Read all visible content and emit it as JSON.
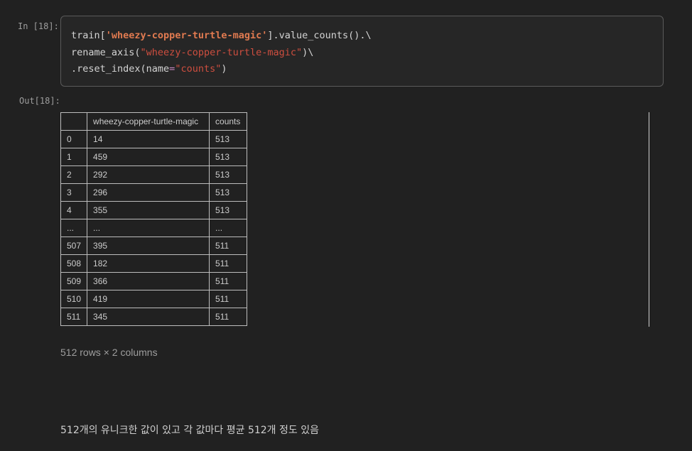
{
  "input_prompt": "In [18]:",
  "output_prompt": "Out[18]:",
  "code": {
    "line1": {
      "a": "train[",
      "b": "'wheezy-copper-turtle-magic'",
      "c": "].value_counts().\\"
    },
    "line2": {
      "a": "rename_axis(",
      "b": "\"wheezy-copper-turtle-magic\"",
      "c": ")\\"
    },
    "line3": {
      "a": ".reset_index(name",
      "b": "=",
      "c": "\"counts\"",
      "d": ")"
    }
  },
  "table": {
    "headers": [
      "",
      "wheezy-copper-turtle-magic",
      "counts"
    ],
    "rows": [
      [
        "0",
        "14",
        "513"
      ],
      [
        "1",
        "459",
        "513"
      ],
      [
        "2",
        "292",
        "513"
      ],
      [
        "3",
        "296",
        "513"
      ],
      [
        "4",
        "355",
        "513"
      ],
      [
        "...",
        "...",
        "..."
      ],
      [
        "507",
        "395",
        "511"
      ],
      [
        "508",
        "182",
        "511"
      ],
      [
        "509",
        "366",
        "511"
      ],
      [
        "510",
        "419",
        "511"
      ],
      [
        "511",
        "345",
        "511"
      ]
    ]
  },
  "shape_info": "512 rows × 2 columns",
  "markdown_text": "512개의 유니크한 값이 있고 각 값마다 평균 512개 정도 있음"
}
